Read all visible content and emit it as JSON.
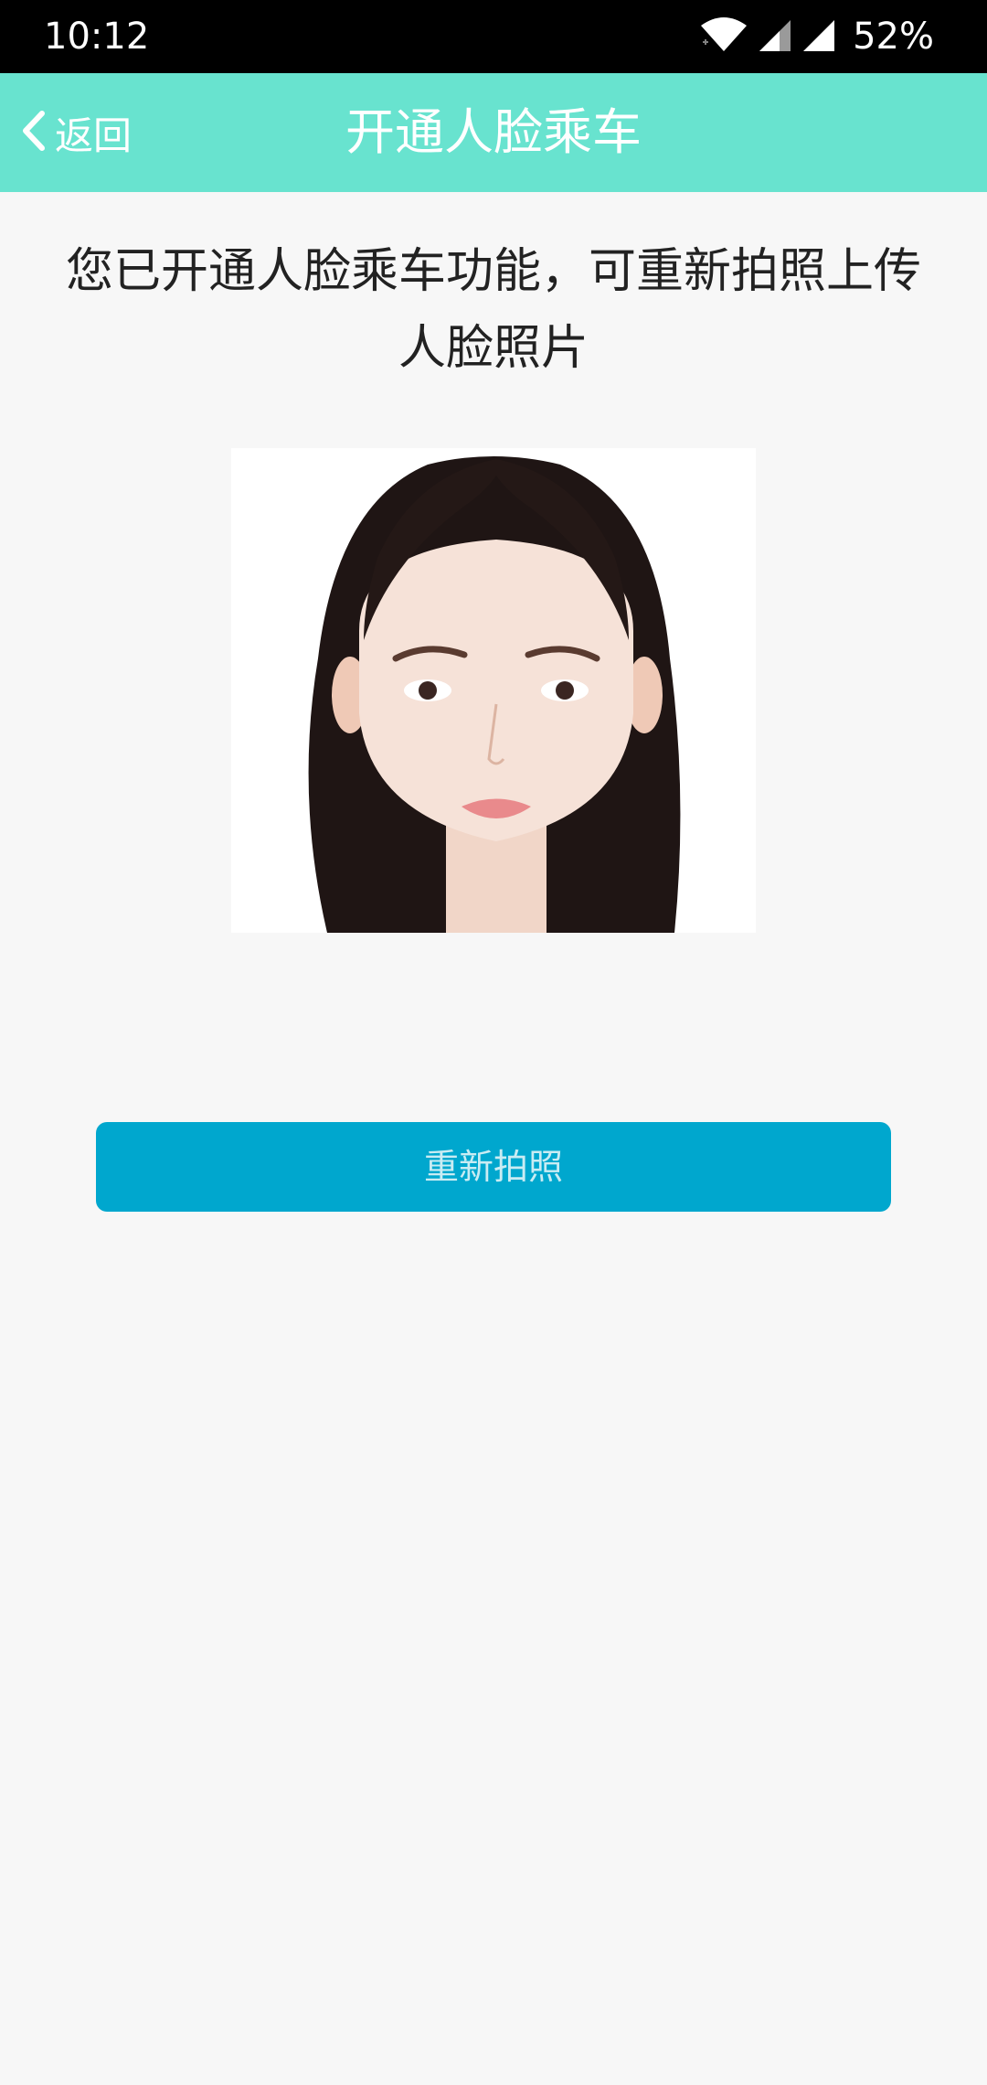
{
  "status_bar": {
    "time": "10:12",
    "battery": "52%",
    "icons": [
      "wifi-icon",
      "signal-icon",
      "signal-icon"
    ]
  },
  "header": {
    "back_icon": "chevron-left-icon",
    "back_label": "返回",
    "title": "开通人脸乘车",
    "background_color": "#68e3cf"
  },
  "main": {
    "message": "您已开通人脸乘车功能，可重新拍照上传人脸照片",
    "photo_description": "face-photo",
    "retake_button_label": "重新拍照",
    "button_color": "#00a7ce"
  }
}
